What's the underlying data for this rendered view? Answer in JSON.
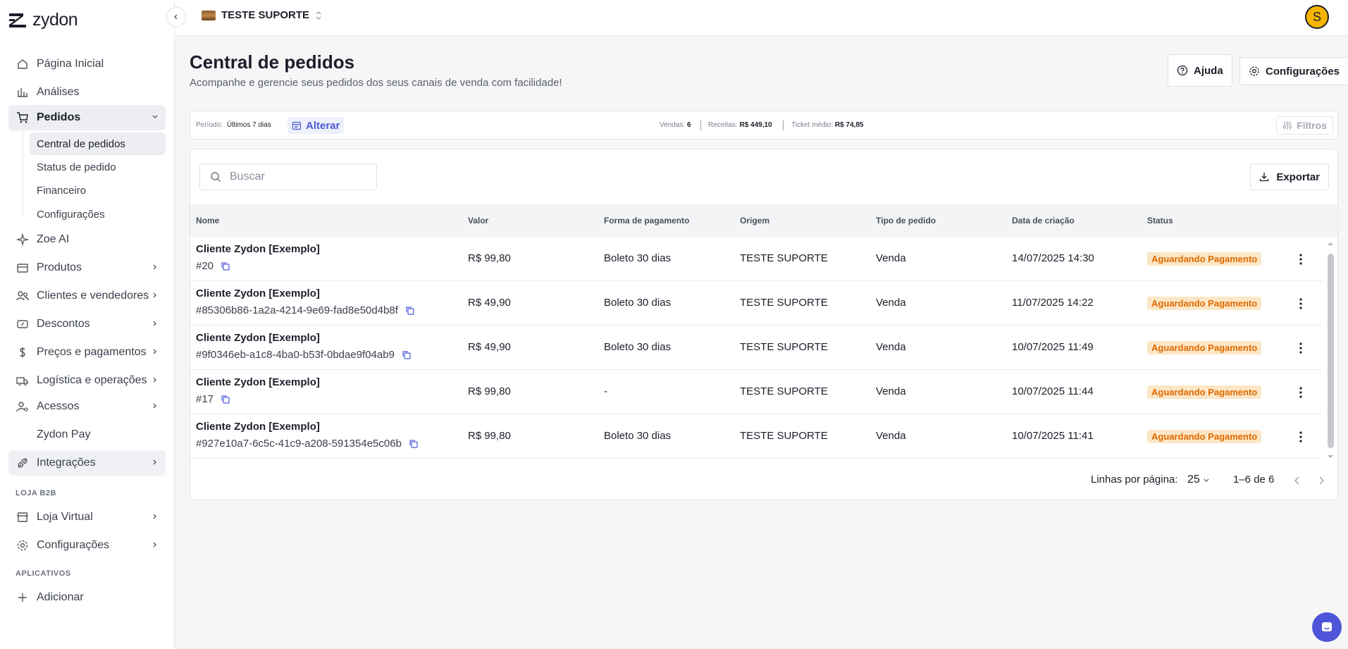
{
  "app": {
    "logo_text": "zydon"
  },
  "topbar": {
    "store_name": "TESTE SUPORTE",
    "avatar_letter": "S"
  },
  "sidebar": {
    "items": [
      {
        "label": "Página Inicial",
        "icon": "home-icon"
      },
      {
        "label": "Análises",
        "icon": "chart-bars-icon"
      },
      {
        "label": "Pedidos",
        "icon": "cart-icon"
      },
      {
        "label": "Zoe AI",
        "icon": "sparkle-icon"
      },
      {
        "label": "Produtos",
        "icon": "box-icon"
      },
      {
        "label": "Clientes e vendedores",
        "icon": "users-icon"
      },
      {
        "label": "Descontos",
        "icon": "discount-icon"
      },
      {
        "label": "Preços e pagamentos",
        "icon": "dollar-icon"
      },
      {
        "label": "Logística e operações",
        "icon": "truck-icon"
      },
      {
        "label": "Acessos",
        "icon": "key-users-icon"
      },
      {
        "label": "Zydon Pay",
        "icon": "wallet-icon"
      },
      {
        "label": "Integrações",
        "icon": "plug-icon"
      }
    ],
    "subitems": [
      "Central de pedidos",
      "Status de pedido",
      "Financeiro",
      "Configurações"
    ],
    "section_b2b": "LOJA B2B",
    "b2b_items": [
      {
        "label": "Loja Virtual",
        "icon": "store-icon"
      },
      {
        "label": "Configurações",
        "icon": "gear-icon"
      }
    ],
    "section_apps": "APLICATIVOS",
    "add_label": "Adicionar"
  },
  "header": {
    "title": "Central de pedidos",
    "subtitle": "Acompanhe e gerencie seus pedidos dos seus canais de venda com facilidade!",
    "help_label": "Ajuda",
    "settings_label": "Configurações"
  },
  "filterbar": {
    "period_label": "Período:",
    "period_value": "Últimos 7 dias",
    "change_label": "Alterar",
    "sales_label": "Vendas:",
    "sales_value": "6",
    "revenue_label": "Receitas:",
    "revenue_value": "R$ 449,10",
    "ticket_label": "Ticket médio:",
    "ticket_value": "R$ 74,85",
    "filters_label": "Filtros"
  },
  "table": {
    "search_placeholder": "Buscar",
    "export_label": "Exportar",
    "columns": [
      "Nome",
      "Valor",
      "Forma de pagamento",
      "Origem",
      "Tipo de pedido",
      "Data de criação",
      "Status"
    ],
    "rows": [
      {
        "name": "Cliente Zydon [Exemplo]",
        "id": "#20",
        "value": "R$ 99,80",
        "payment": "Boleto 30 dias",
        "origin": "TESTE SUPORTE",
        "type": "Venda",
        "date": "14/07/2025 14:30",
        "status": "Aguardando Pagamento"
      },
      {
        "name": "Cliente Zydon [Exemplo]",
        "id": "#85306b86-1a2a-4214-9e69-fad8e50d4b8f",
        "value": "R$ 49,90",
        "payment": "Boleto 30 dias",
        "origin": "TESTE SUPORTE",
        "type": "Venda",
        "date": "11/07/2025 14:22",
        "status": "Aguardando Pagamento"
      },
      {
        "name": "Cliente Zydon [Exemplo]",
        "id": "#9f0346eb-a1c8-4ba0-b53f-0bdae9f04ab9",
        "value": "R$ 49,90",
        "payment": "Boleto 30 dias",
        "origin": "TESTE SUPORTE",
        "type": "Venda",
        "date": "10/07/2025 11:49",
        "status": "Aguardando Pagamento"
      },
      {
        "name": "Cliente Zydon [Exemplo]",
        "id": "#17",
        "value": "R$ 99,80",
        "payment": "-",
        "origin": "TESTE SUPORTE",
        "type": "Venda",
        "date": "10/07/2025 11:44",
        "status": "Aguardando Pagamento"
      },
      {
        "name": "Cliente Zydon [Exemplo]",
        "id": "#927e10a7-6c5c-41c9-a208-591354e5c06b",
        "value": "R$ 99,80",
        "payment": "Boleto 30 dias",
        "origin": "TESTE SUPORTE",
        "type": "Venda",
        "date": "10/07/2025 11:41",
        "status": "Aguardando Pagamento"
      }
    ]
  },
  "pagination": {
    "rows_label": "Linhas por página:",
    "rows_value": "25",
    "range": "1–6 de 6"
  },
  "colors": {
    "accent": "#4e5bd6",
    "status_bg": "#fbe6c6",
    "status_text": "#e06a00"
  }
}
